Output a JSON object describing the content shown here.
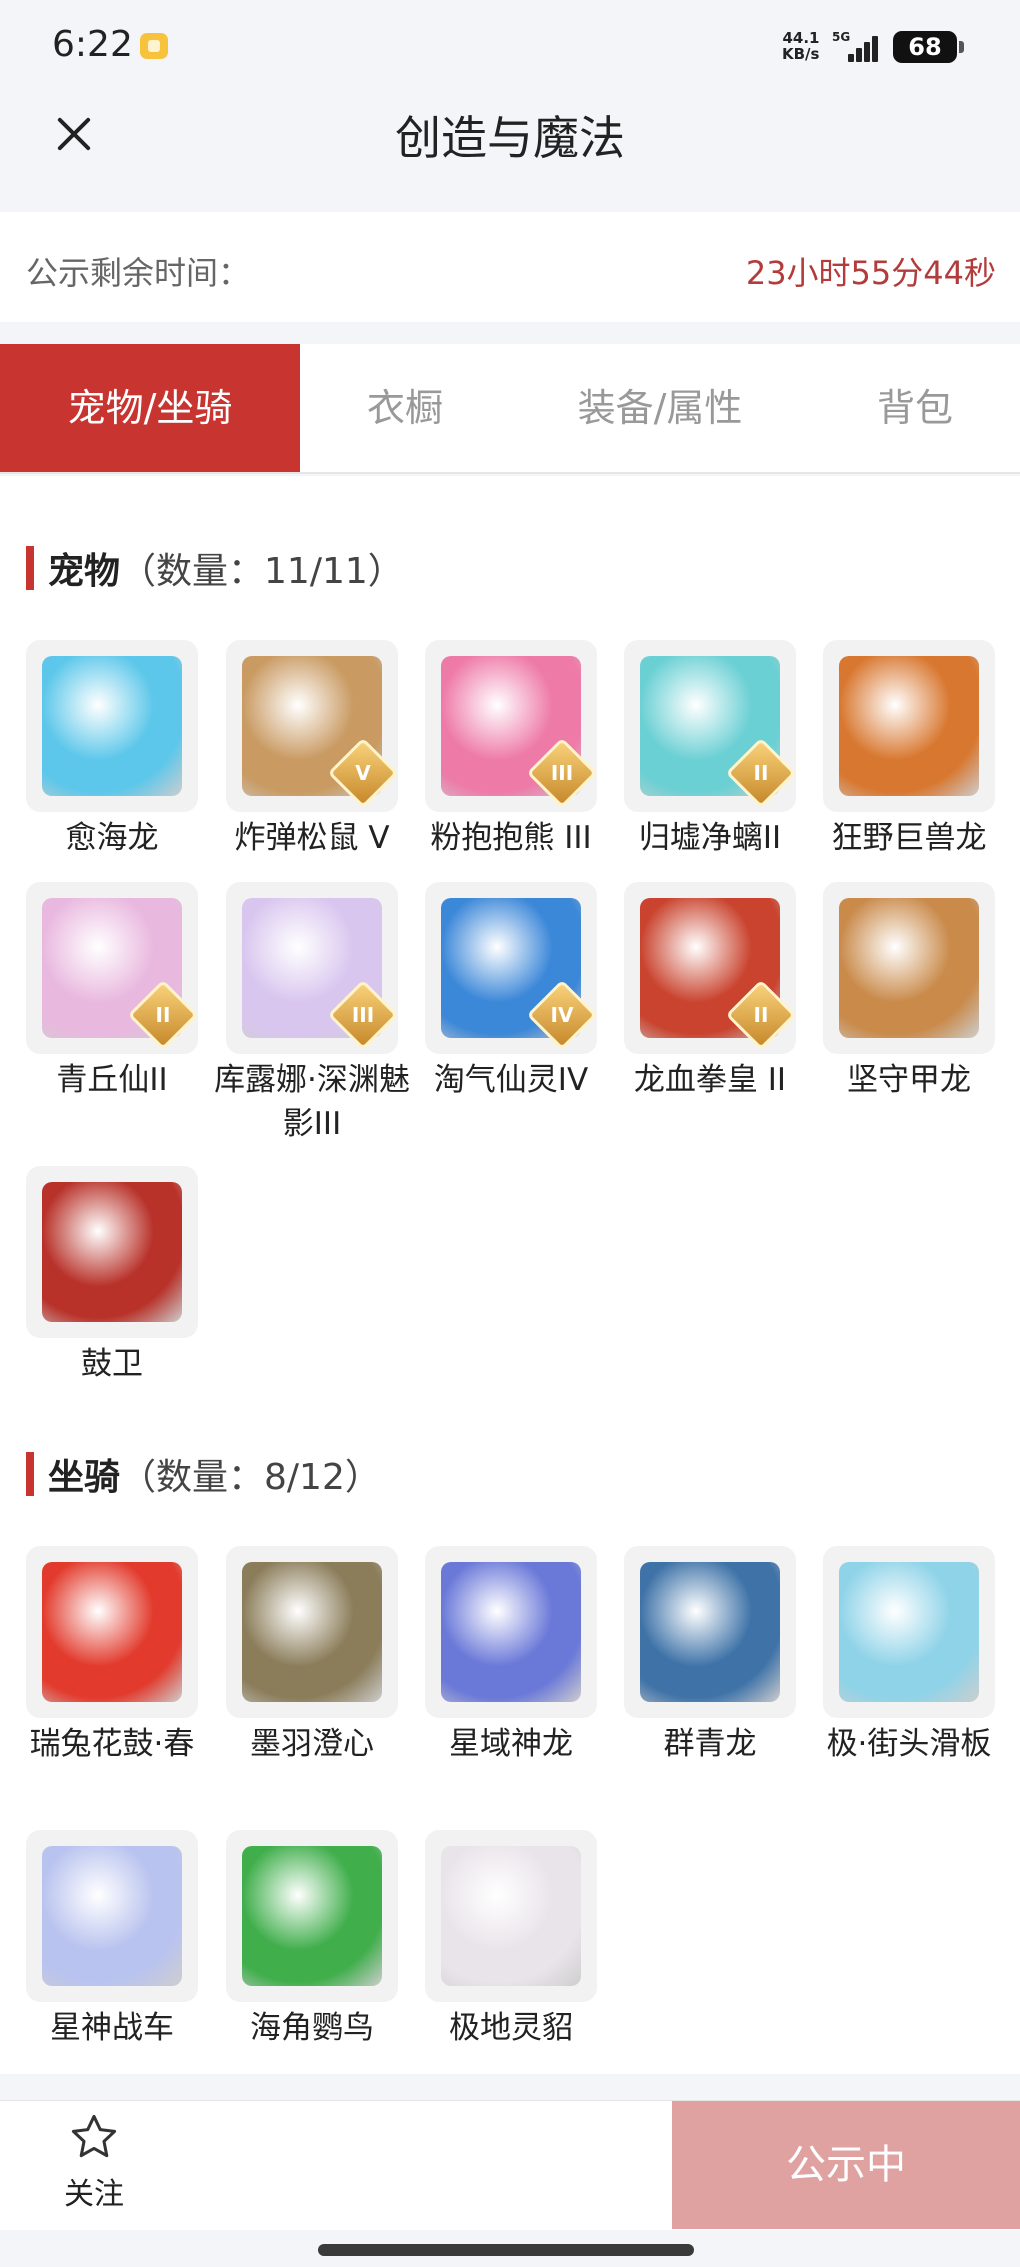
{
  "status_bar": {
    "time": "6:22",
    "net_speed_value": "44.1",
    "net_speed_unit": "KB/s",
    "network_type": "5G",
    "battery": "68"
  },
  "header": {
    "title": "创造与魔法",
    "close_icon": "close-icon"
  },
  "countdown": {
    "label": "公示剩余时间：",
    "value": "23小时55分44秒"
  },
  "tabs": [
    {
      "label": "宠物/坐骑",
      "active": true
    },
    {
      "label": "衣橱",
      "active": false
    },
    {
      "label": "装备/属性",
      "active": false
    },
    {
      "label": "背包",
      "active": false
    }
  ],
  "pets": {
    "title": "宠物",
    "count": "（数量：11/11）",
    "items": [
      {
        "name": "愈海龙",
        "badge": "",
        "color": "#5cc7ea"
      },
      {
        "name": "炸弹松鼠 V",
        "badge": "V",
        "color": "#c99a62"
      },
      {
        "name": "粉抱抱熊 III",
        "badge": "III",
        "color": "#ee7aa8"
      },
      {
        "name": "归墟净螭II",
        "badge": "II",
        "color": "#6bd0d4"
      },
      {
        "name": "狂野巨兽龙",
        "badge": "",
        "color": "#d8772f"
      },
      {
        "name": "青丘仙II",
        "badge": "II",
        "color": "#e9b8df"
      },
      {
        "name": "库露娜·深渊魅影III",
        "badge": "III",
        "color": "#d9c6ef"
      },
      {
        "name": "淘气仙灵IV",
        "badge": "IV",
        "color": "#3b87d8"
      },
      {
        "name": "龙血拳皇 II",
        "badge": "II",
        "color": "#c9432e"
      },
      {
        "name": "坚守甲龙",
        "badge": "",
        "color": "#c98a4a"
      },
      {
        "name": "鼓卫",
        "badge": "",
        "color": "#b8322a"
      }
    ]
  },
  "mounts": {
    "title": "坐骑",
    "count": "（数量：8/12）",
    "items": [
      {
        "name": "瑞兔花鼓·春",
        "color": "#e23a2c"
      },
      {
        "name": "墨羽澄心",
        "color": "#8b7d5a"
      },
      {
        "name": "星域神龙",
        "color": "#6a78d8"
      },
      {
        "name": "群青龙",
        "color": "#3f73a8"
      },
      {
        "name": "极·街头滑板",
        "color": "#8fd3e8"
      },
      {
        "name": "星神战车",
        "color": "#b9c3ef"
      },
      {
        "name": "海角鹦鸟",
        "color": "#3fae4b"
      },
      {
        "name": "极地灵貂",
        "color": "#e9e4ea"
      }
    ]
  },
  "bottom_bar": {
    "follow_label": "关注",
    "follow_icon": "star-icon",
    "status_label": "公示中"
  },
  "colors": {
    "accent": "#c8342f",
    "countdown": "#b23b3b",
    "status_button": "#dfa2a0"
  }
}
